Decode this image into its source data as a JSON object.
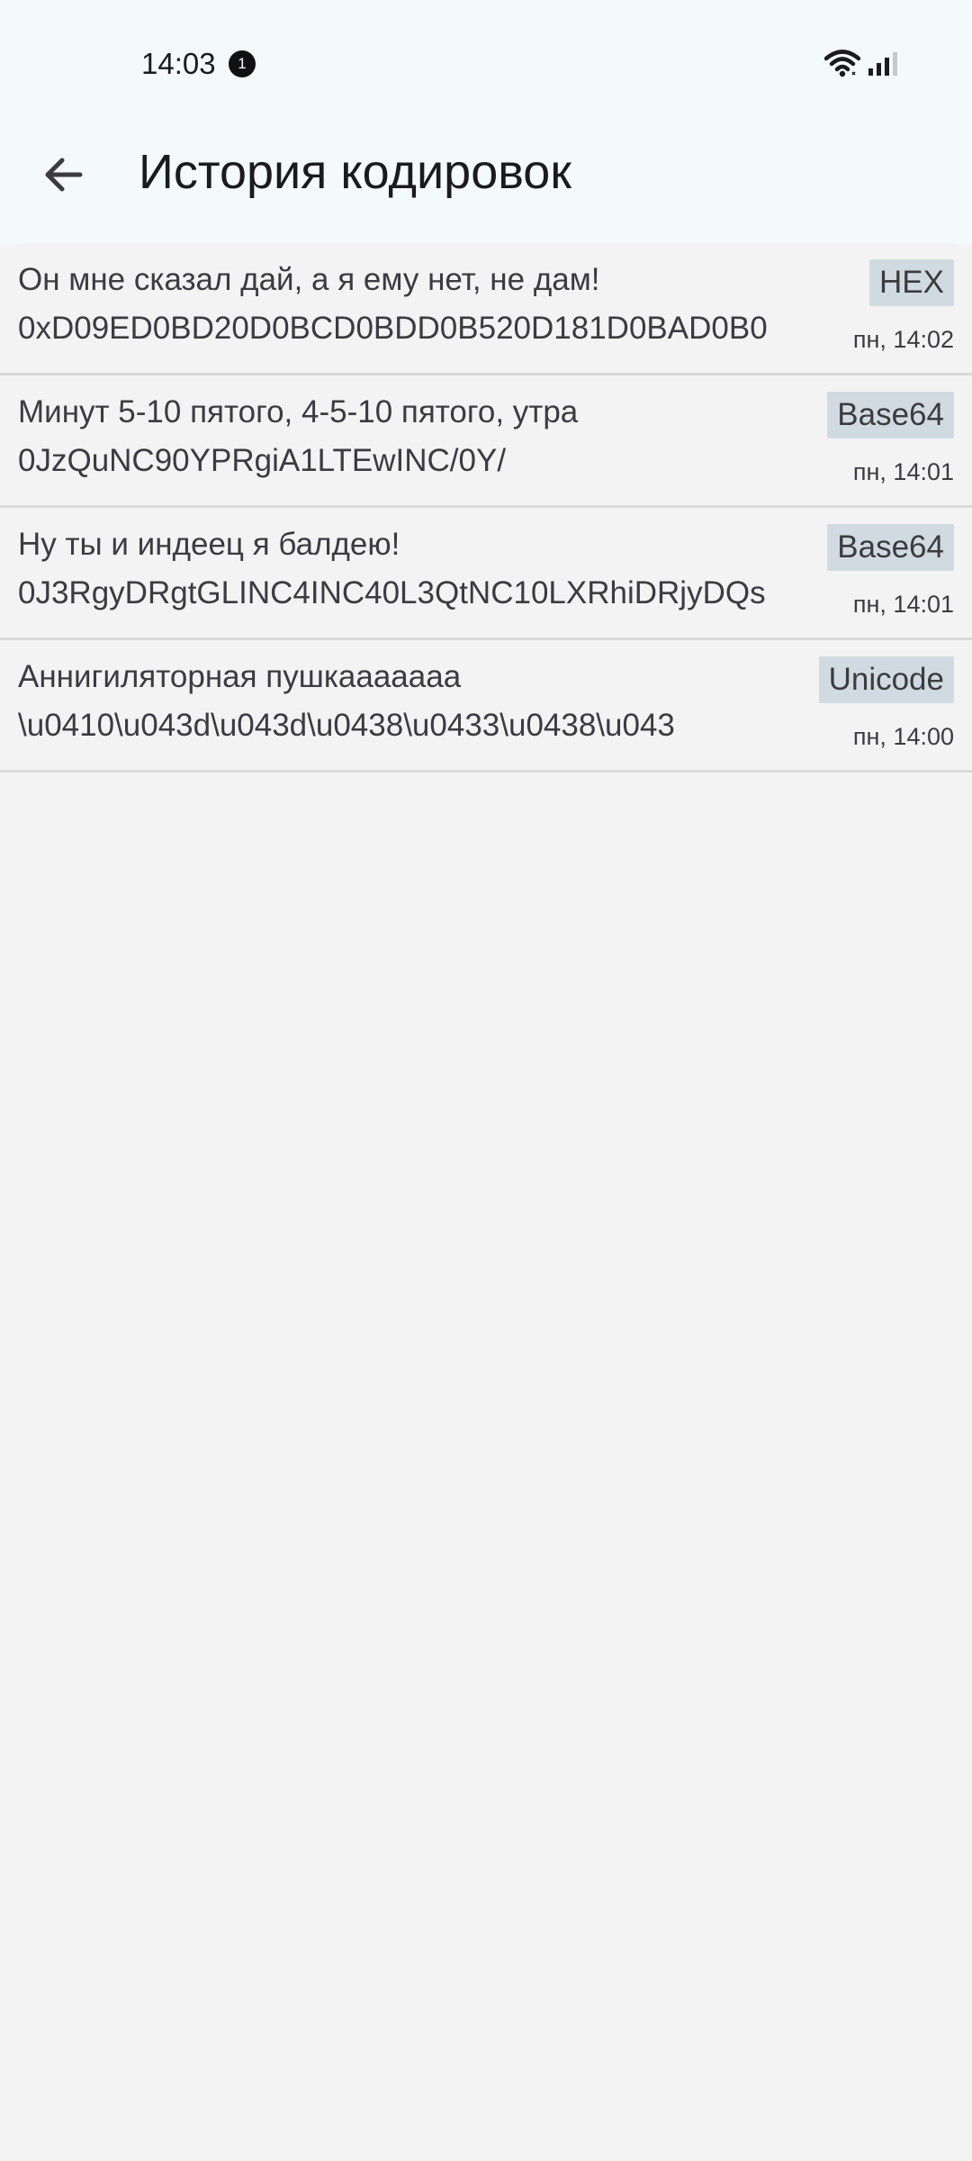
{
  "status_bar": {
    "time": "14:03",
    "notification_count": "1",
    "wifi_icon": "wifi-icon",
    "signal_icon": "cellular-signal-icon"
  },
  "app_bar": {
    "back_icon": "arrow-left-icon",
    "title": "История кодировок"
  },
  "history": [
    {
      "original": "Он мне сказал дай, а я ему нет, не дам!",
      "encoded": "0xD09ED0BD20D0BCD0BDD0B520D181D0BAD0B0",
      "encoding": "HEX",
      "time": "пн, 14:02"
    },
    {
      "original": "Минут 5-10 пятого, 4-5-10 пятого, утра",
      "encoded": "0JzQuNC90YPRgiA1LTEwINC/0Y/",
      "encoding": "Base64",
      "time": "пн, 14:01"
    },
    {
      "original": "Ну ты и индеец я балдею!",
      "encoded": "0J3RgyDRgtGLINC4INC40L3QtNC10LXRhiDRjyDQs",
      "encoding": "Base64",
      "time": "пн, 14:01"
    },
    {
      "original": "Аннигиляторная пушкааааааа",
      "encoded": "\\u0410\\u043d\\u043d\\u0438\\u0433\\u0438\\u043",
      "encoding": "Unicode",
      "time": "пн, 14:00"
    }
  ],
  "colors": {
    "top_background": "#f4f9fc",
    "list_background": "#f3f3f3",
    "badge_background": "#d0dbe1",
    "divider": "#d9d9d9"
  }
}
